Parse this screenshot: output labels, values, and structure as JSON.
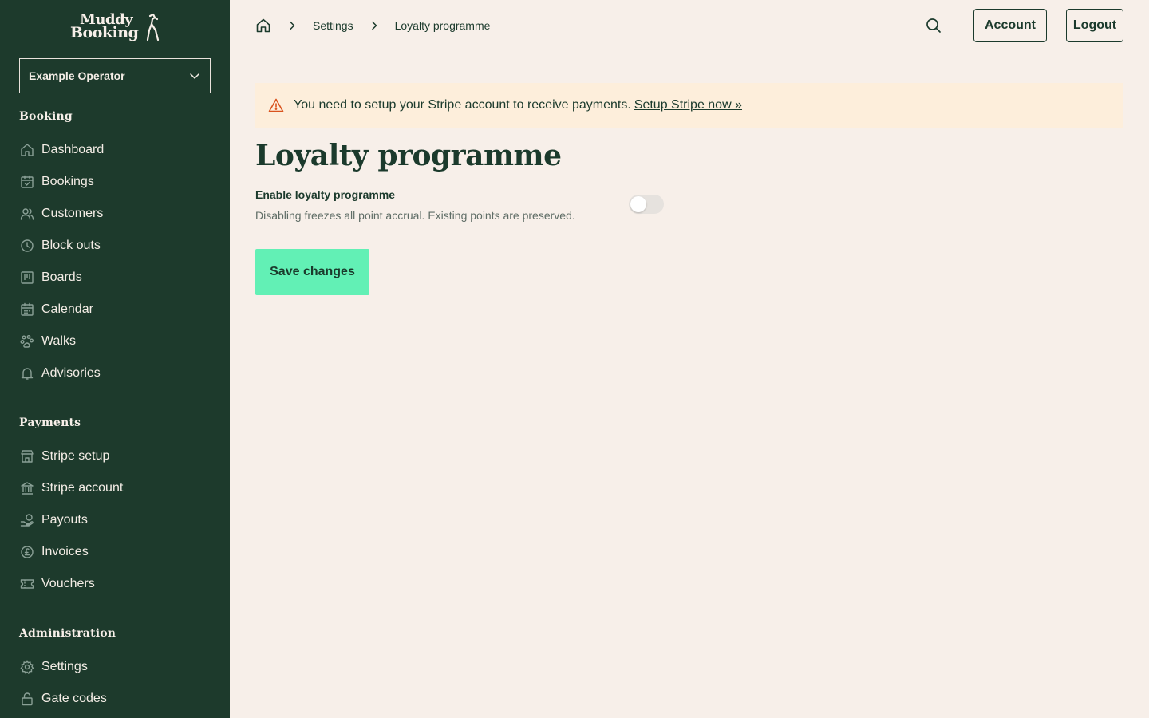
{
  "brand": {
    "line1": "Muddy",
    "line2": "Booking"
  },
  "operator_select": {
    "value": "Example Operator"
  },
  "sidebar": {
    "sections": [
      {
        "title": "Booking",
        "items": [
          {
            "label": "Dashboard",
            "icon": "home-icon"
          },
          {
            "label": "Bookings",
            "icon": "calendar-check-icon"
          },
          {
            "label": "Customers",
            "icon": "users-icon"
          },
          {
            "label": "Block outs",
            "icon": "clock-icon"
          },
          {
            "label": "Boards",
            "icon": "board-icon"
          },
          {
            "label": "Calendar",
            "icon": "calendar-icon"
          },
          {
            "label": "Walks",
            "icon": "paw-icon"
          },
          {
            "label": "Advisories",
            "icon": "bell-icon"
          }
        ]
      },
      {
        "title": "Payments",
        "items": [
          {
            "label": "Stripe setup",
            "icon": "store-icon"
          },
          {
            "label": "Stripe account",
            "icon": "bank-icon"
          },
          {
            "label": "Payouts",
            "icon": "payout-icon"
          },
          {
            "label": "Invoices",
            "icon": "pound-icon"
          },
          {
            "label": "Vouchers",
            "icon": "ticket-icon"
          }
        ]
      },
      {
        "title": "Administration",
        "items": [
          {
            "label": "Settings",
            "icon": "gear-icon"
          },
          {
            "label": "Gate codes",
            "icon": "lock-icon"
          }
        ]
      }
    ]
  },
  "breadcrumb": {
    "items": [
      "Settings",
      "Loyalty programme"
    ]
  },
  "header": {
    "account_label": "Account",
    "logout_label": "Logout"
  },
  "alert": {
    "message": "You need to setup your Stripe account to receive payments.",
    "link_text": "Setup Stripe now »"
  },
  "page": {
    "title": "Loyalty programme",
    "field_label": "Enable loyalty programme",
    "field_help": "Disabling freezes all point accrual. Existing points are preserved.",
    "toggle_on": false,
    "save_label": "Save changes"
  },
  "colors": {
    "sidebar_bg": "#1d3a2c",
    "page_bg": "#f7efe9",
    "accent": "#62f0b5",
    "alert_bg": "#fdeedb",
    "warning": "#d9531e"
  }
}
